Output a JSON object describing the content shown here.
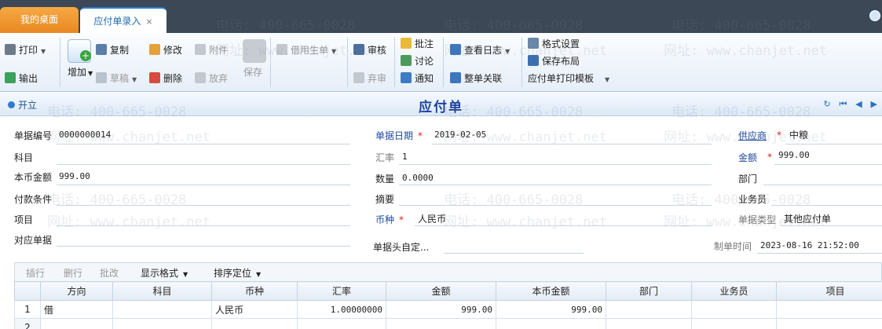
{
  "tabs": {
    "desktop": "我的桌面",
    "entry": "应付单录入",
    "close": "×"
  },
  "toolbar": {
    "print": "打印",
    "export": "输出",
    "add": "增加",
    "copy": "复制",
    "draft": "草稿",
    "edit": "修改",
    "delete": "删除",
    "attach": "附件",
    "abandon": "放弃",
    "save": "保存",
    "borrow": "借用生单",
    "audit": "审核",
    "unaudit": "弃审",
    "annotate": "批注",
    "discuss": "讨论",
    "notify": "通知",
    "view_log": "查看日志",
    "link_all": "整单关联",
    "format_setting": "格式设置",
    "save_layout": "保存布局",
    "print_template": "应付单打印模板"
  },
  "titlebar": {
    "status": "开立",
    "title": "应付单"
  },
  "form": {
    "doc_no_label": "单据编号",
    "doc_no": "0000000014",
    "subject_label": "科目",
    "subject": "",
    "local_amount_label": "本币金额",
    "local_amount": "999.00",
    "pay_terms_label": "付款条件",
    "project_label": "项目",
    "related_doc_label": "对应单据",
    "doc_date_label": "单据日期",
    "doc_date": "2019-02-05",
    "rate_label": "汇率",
    "rate": "1",
    "qty_label": "数量",
    "qty": "0.0000",
    "summary_label": "摘要",
    "currency_label": "币种",
    "currency": "人民币",
    "custom_header_label": "单据头自定...",
    "supplier_label": "供应商",
    "supplier": "中粮",
    "amount_label": "金额",
    "amount": "999.00",
    "dept_label": "部门",
    "salesman_label": "业务员",
    "doc_type_label": "单据类型",
    "doc_type": "其他应付单",
    "created_label": "制单时间",
    "created": "2023-08-16 21:52:00",
    "required_mark": "*"
  },
  "gridbar": {
    "insert": "插行",
    "delete_row": "删行",
    "batch_edit": "批改",
    "display_format": "显示格式",
    "sort_locate": "排序定位"
  },
  "grid": {
    "columns": [
      "方向",
      "科目",
      "币种",
      "汇率",
      "金额",
      "本币金额",
      "部门",
      "业务员",
      "项目"
    ],
    "rows": [
      {
        "idx": "1",
        "direction": "借",
        "subject": "",
        "currency": "人民币",
        "rate": "1.00000000",
        "amount": "999.00",
        "local_amount": "999.00",
        "dept": "",
        "salesman": "",
        "project": ""
      },
      {
        "idx": "2"
      }
    ]
  },
  "watermark": {
    "phone": "电话: 400-665-0028",
    "site": "网址: www.chanjet.net"
  },
  "colors": {
    "accent": "#2b7bd0",
    "tab_orange": "#f09a33",
    "title_blue": "#1c3fa0"
  }
}
